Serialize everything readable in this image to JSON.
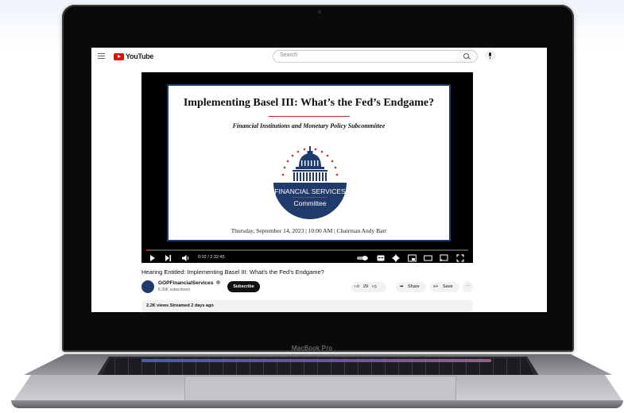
{
  "device": {
    "label": "MacBook Pro"
  },
  "youtube": {
    "logo_text": "YouTube",
    "search": {
      "placeholder": "Search"
    }
  },
  "video": {
    "slide": {
      "title": "Implementing Basel III: What’s the Fed’s Endgame?",
      "subtitle": "Financial Institutions and Monetary Policy Subcommittee",
      "seal_line1": "FINANCIAL SERVICES",
      "seal_line2": "Committee",
      "date_line": "Thursday, September 14, 2023 | 10:00 AM | Chairman Andy Barr"
    },
    "time": "0:02 / 2:32:45",
    "progress": 0.0002,
    "title": "Hearing Entitled: Implementing Basel III: What’s the Fed’s Endgame?",
    "channel": {
      "name": "GOPFinancialServices",
      "subscribers": "6.39K subscribers",
      "subscribe_label": "Subscribe"
    },
    "actions": {
      "likes": "29",
      "share": "Share",
      "save": "Save"
    },
    "meta": "2.2K views  Streamed 2 days ago"
  },
  "colors": {
    "youtube_red": "#ff0000",
    "seal_navy": "#1f3a6b",
    "accent_red": "#c0392b"
  }
}
